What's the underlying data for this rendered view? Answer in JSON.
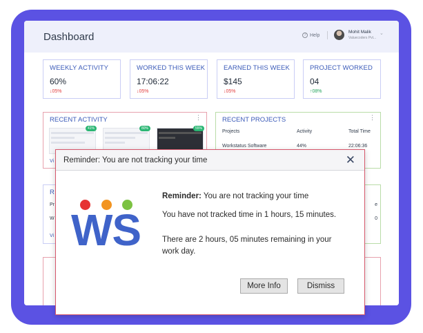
{
  "header": {
    "title": "Dashboard",
    "help_label": "Help",
    "user_name": "Mohit Malik",
    "user_company": "Valuecoders Pvt..."
  },
  "stats": [
    {
      "label": "WEEKLY ACTIVITY",
      "value": "60%",
      "change": "05%",
      "direction": "down"
    },
    {
      "label": "WORKED THIS WEEK",
      "value": "17:06:22",
      "change": "05%",
      "direction": "down"
    },
    {
      "label": "EARNED THIS WEEK",
      "value": "$145",
      "change": "05%",
      "direction": "down"
    },
    {
      "label": "PROJECT WORKED",
      "value": "04",
      "change": "08%",
      "direction": "up"
    }
  ],
  "recent_activity": {
    "title": "RECENT ACTIVITY",
    "badges": [
      "41%",
      "80%",
      "55%"
    ],
    "view_link": "Vi"
  },
  "recent_projects": {
    "title": "RECENT PROJECTS",
    "columns": [
      "Projects",
      "Activity",
      "Total Time"
    ],
    "rows": [
      {
        "project": "Workstatus Software",
        "activity": "44%",
        "time": "22:06:36"
      }
    ]
  },
  "panel_left_2": {
    "title": "R",
    "line1": "Pr",
    "line2": "W",
    "view_link": "Vi"
  },
  "panel_right_2": {
    "line1": "e",
    "line2": "0"
  },
  "dialog": {
    "title": "Reminder: You are not tracking your time",
    "close_glyph": "✕",
    "logo_text": "WS",
    "logo_colors": [
      "#e63232",
      "#f29421",
      "#7cc242"
    ],
    "msg_bold": "Reminder:",
    "msg_rest": " You are not tracking your time",
    "msg_line2": "You have not tracked time in 1 hours, 15 minutes.",
    "msg_line3": "There are 2 hours, 05 minutes remaining in your work day.",
    "more_info_label": "More Info",
    "dismiss_label": "Dismiss"
  },
  "colors": {
    "frame": "#5b52e3",
    "accent_blue": "#3a5ab8",
    "logo_blue": "#3f63c9",
    "dialog_border": "#d6566a",
    "down": "#e23d3d",
    "up": "#22a35b"
  }
}
